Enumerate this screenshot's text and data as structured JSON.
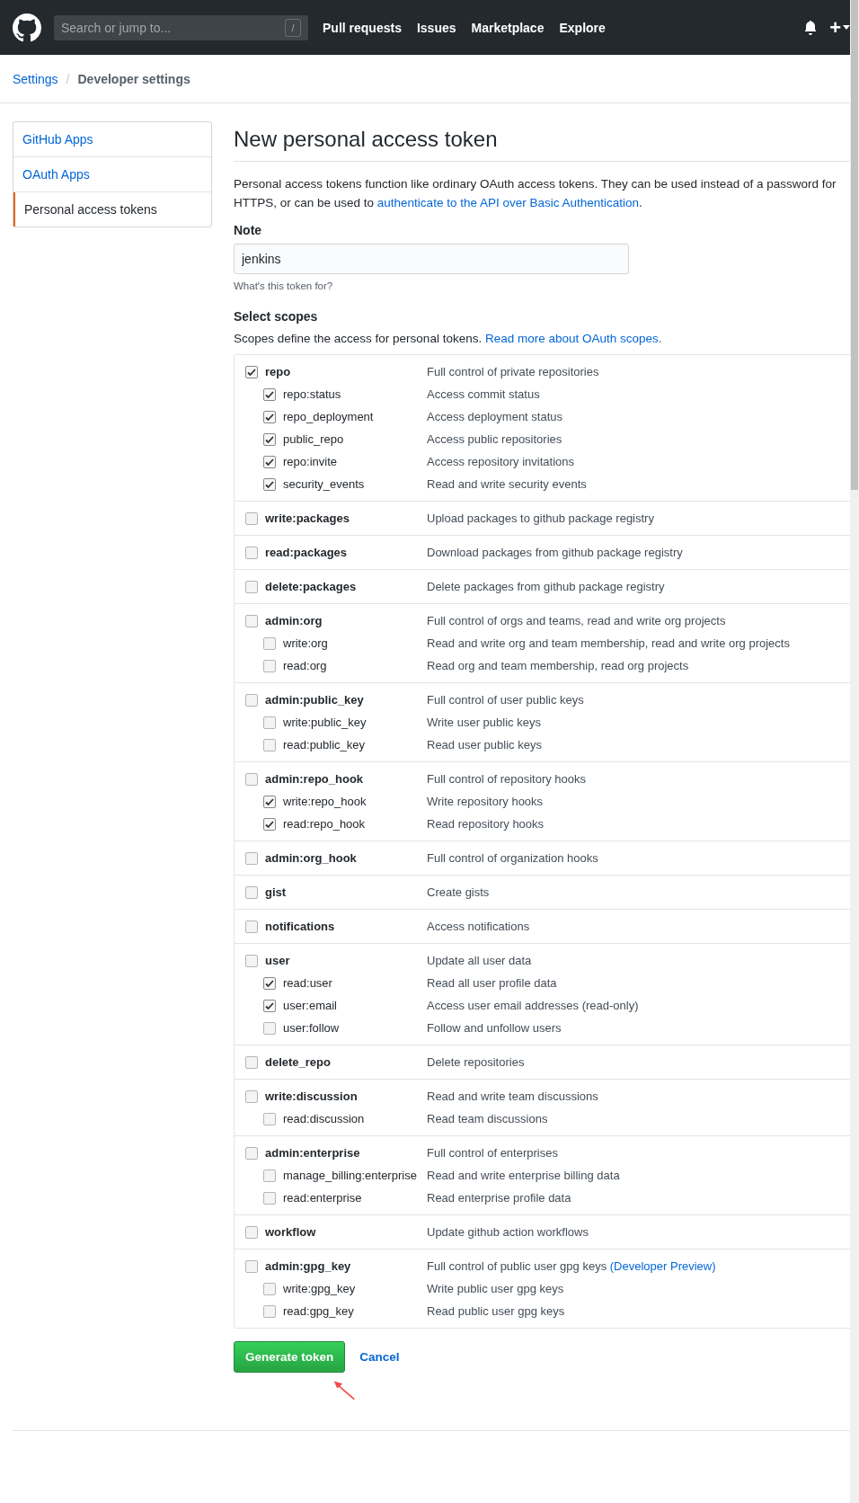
{
  "header": {
    "search_placeholder": "Search or jump to...",
    "search_key": "/",
    "nav": [
      "Pull requests",
      "Issues",
      "Marketplace",
      "Explore"
    ],
    "plus": "+"
  },
  "breadcrumb": {
    "link": "Settings",
    "separator": "/",
    "current": "Developer settings"
  },
  "sidebar": {
    "items": [
      {
        "label": "GitHub Apps",
        "selected": false
      },
      {
        "label": "OAuth Apps",
        "selected": false
      },
      {
        "label": "Personal access tokens",
        "selected": true
      }
    ]
  },
  "page_title": "New personal access token",
  "description": {
    "line_1": "Personal access tokens function like ordinary OAuth access tokens. They can be used instead of a password for",
    "line_2": "HTTPS, or can be used to ",
    "link": "authenticate to the API over Basic Authentication",
    "end": "."
  },
  "note": {
    "label": "Note",
    "value": "jenkins",
    "hint": "What's this token for?"
  },
  "scopes": {
    "title": "Select scopes",
    "intro": "Scopes define the access for personal tokens. ",
    "intro_link": "Read more about OAuth scopes.",
    "groups": [
      {
        "name": "repo",
        "description": "Full control of private repositories",
        "checked": true,
        "children": [
          {
            "name": "repo:status",
            "description": "Access commit status",
            "checked": true
          },
          {
            "name": "repo_deployment",
            "description": "Access deployment status",
            "checked": true
          },
          {
            "name": "public_repo",
            "description": "Access public repositories",
            "checked": true
          },
          {
            "name": "repo:invite",
            "description": "Access repository invitations",
            "checked": true
          },
          {
            "name": "security_events",
            "description": "Read and write security events",
            "checked": true
          }
        ]
      },
      {
        "name": "write:packages",
        "description": "Upload packages to github package registry",
        "checked": false
      },
      {
        "name": "read:packages",
        "description": "Download packages from github package registry",
        "checked": false
      },
      {
        "name": "delete:packages",
        "description": "Delete packages from github package registry",
        "checked": false
      },
      {
        "name": "admin:org",
        "description": "Full control of orgs and teams, read and write org projects",
        "checked": false,
        "children": [
          {
            "name": "write:org",
            "description": "Read and write org and team membership, read and write org projects",
            "checked": false
          },
          {
            "name": "read:org",
            "description": "Read org and team membership, read org projects",
            "checked": false
          }
        ]
      },
      {
        "name": "admin:public_key",
        "description": "Full control of user public keys",
        "checked": false,
        "children": [
          {
            "name": "write:public_key",
            "description": "Write user public keys",
            "checked": false
          },
          {
            "name": "read:public_key",
            "description": "Read user public keys",
            "checked": false
          }
        ]
      },
      {
        "name": "admin:repo_hook",
        "description": "Full control of repository hooks",
        "checked": false,
        "children": [
          {
            "name": "write:repo_hook",
            "description": "Write repository hooks",
            "checked": true
          },
          {
            "name": "read:repo_hook",
            "description": "Read repository hooks",
            "checked": true
          }
        ]
      },
      {
        "name": "admin:org_hook",
        "description": "Full control of organization hooks",
        "checked": false
      },
      {
        "name": "gist",
        "description": "Create gists",
        "checked": false
      },
      {
        "name": "notifications",
        "description": "Access notifications",
        "checked": false
      },
      {
        "name": "user",
        "description": "Update all user data",
        "checked": false,
        "children": [
          {
            "name": "read:user",
            "description": "Read all user profile data",
            "checked": true
          },
          {
            "name": "user:email",
            "description": "Access user email addresses (read-only)",
            "checked": true
          },
          {
            "name": "user:follow",
            "description": "Follow and unfollow users",
            "checked": false
          }
        ]
      },
      {
        "name": "delete_repo",
        "description": "Delete repositories",
        "checked": false
      },
      {
        "name": "write:discussion",
        "description": "Read and write team discussions",
        "checked": false,
        "children": [
          {
            "name": "read:discussion",
            "description": "Read team discussions",
            "checked": false
          }
        ]
      },
      {
        "name": "admin:enterprise",
        "description": "Full control of enterprises",
        "checked": false,
        "children": [
          {
            "name": "manage_billing:enterprise",
            "description": "Read and write enterprise billing data",
            "checked": false
          },
          {
            "name": "read:enterprise",
            "description": "Read enterprise profile data",
            "checked": false
          }
        ]
      },
      {
        "name": "workflow",
        "description": "Update github action workflows",
        "checked": false
      },
      {
        "name": "admin:gpg_key",
        "description": "Full control of public user gpg keys ",
        "link": "(Developer Preview)",
        "checked": false,
        "children": [
          {
            "name": "write:gpg_key",
            "description": "Write public user gpg keys",
            "checked": false
          },
          {
            "name": "read:gpg_key",
            "description": "Read public user gpg keys",
            "checked": false
          }
        ]
      }
    ]
  },
  "buttons": {
    "primary": "Generate token",
    "cancel": "Cancel"
  }
}
